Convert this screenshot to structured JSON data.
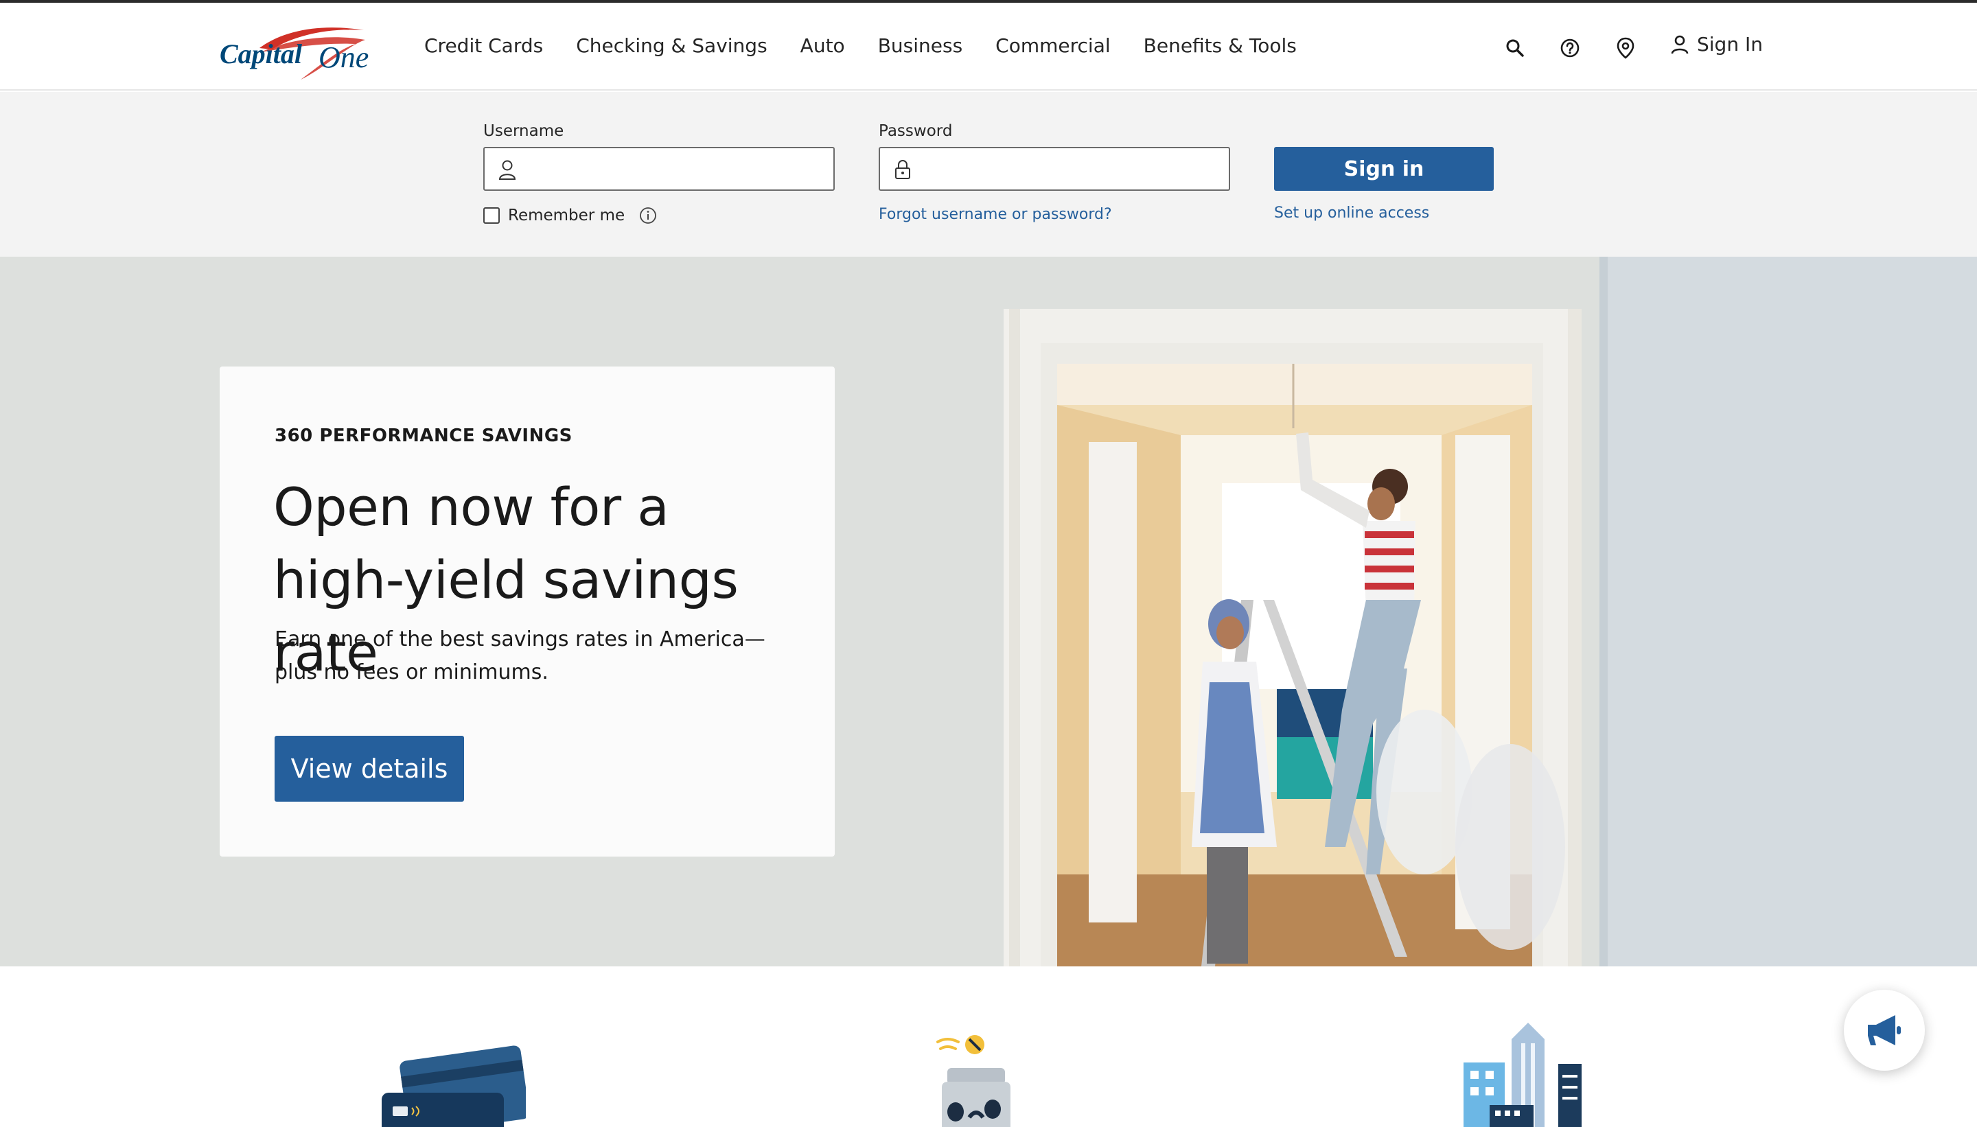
{
  "brand": {
    "logo_text_a": "Capital",
    "logo_text_b": "One",
    "logo_color": "#004879",
    "swoosh_color": "#d03027"
  },
  "nav": {
    "items": [
      {
        "label": "Credit Cards"
      },
      {
        "label": "Checking & Savings"
      },
      {
        "label": "Auto"
      },
      {
        "label": "Business"
      },
      {
        "label": "Commercial"
      },
      {
        "label": "Benefits & Tools"
      }
    ],
    "utility_icons": [
      "search-icon",
      "help-icon",
      "location-pin-icon"
    ],
    "sign_in_label": "Sign In"
  },
  "login": {
    "username_label": "Username",
    "username_value": "",
    "password_label": "Password",
    "password_value": "",
    "sign_in_button": "Sign in",
    "remember_label": "Remember me",
    "remember_checked": false,
    "forgot_link": "Forgot username or password?",
    "setup_link": "Set up online access"
  },
  "hero": {
    "eyebrow": "360 PERFORMANCE SAVINGS",
    "headline": "Open now for a high-yield savings rate",
    "subcopy": "Earn one of the best savings rates in America—plus no fees or minimums.",
    "cta_label": "View details"
  },
  "colors": {
    "primary": "#255f9c",
    "login_bg": "#f3f3f3",
    "text": "#262626"
  },
  "lower": {
    "illustrations": [
      "credit-cards-illustration",
      "savings-jar-illustration",
      "city-buildings-illustration"
    ]
  },
  "feedback": {
    "icon": "megaphone-icon"
  }
}
